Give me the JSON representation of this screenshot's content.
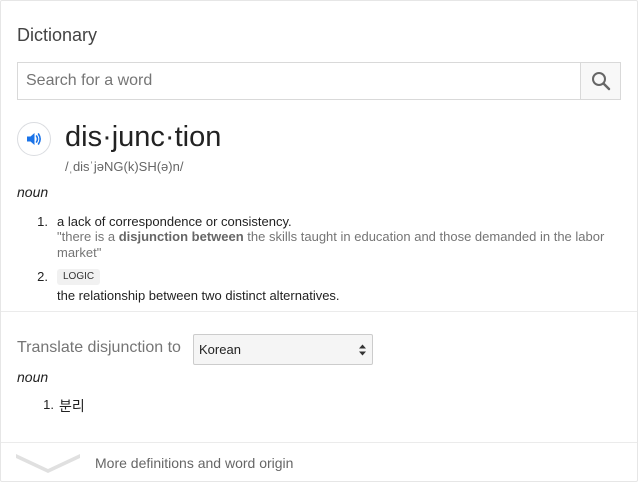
{
  "header": {
    "title": "Dictionary"
  },
  "search": {
    "placeholder": "Search for a word",
    "value": ""
  },
  "entry": {
    "word": "dis·junc·tion",
    "pronunciation": "/ˌdisˈjəNG(k)SH(ə)n/",
    "part_of_speech": "noun",
    "definitions": [
      {
        "number": "1.",
        "text": "a lack of correspondence or consistency.",
        "example_pre": "\"there is a ",
        "example_bold": "disjunction between",
        "example_post": " the skills taught in education and those demanded in the labor market\""
      },
      {
        "number": "2.",
        "label": "LOGIC",
        "text": "the relationship between two distinct alternatives."
      }
    ]
  },
  "translate": {
    "label": "Translate disjunction to",
    "selected_language": "Korean",
    "part_of_speech": "noun",
    "results": [
      {
        "number": "1.",
        "text": "분리"
      }
    ]
  },
  "footer": {
    "more_label": "More definitions and word origin"
  },
  "colors": {
    "accent_blue": "#1a73e8",
    "muted_text": "#757575"
  }
}
